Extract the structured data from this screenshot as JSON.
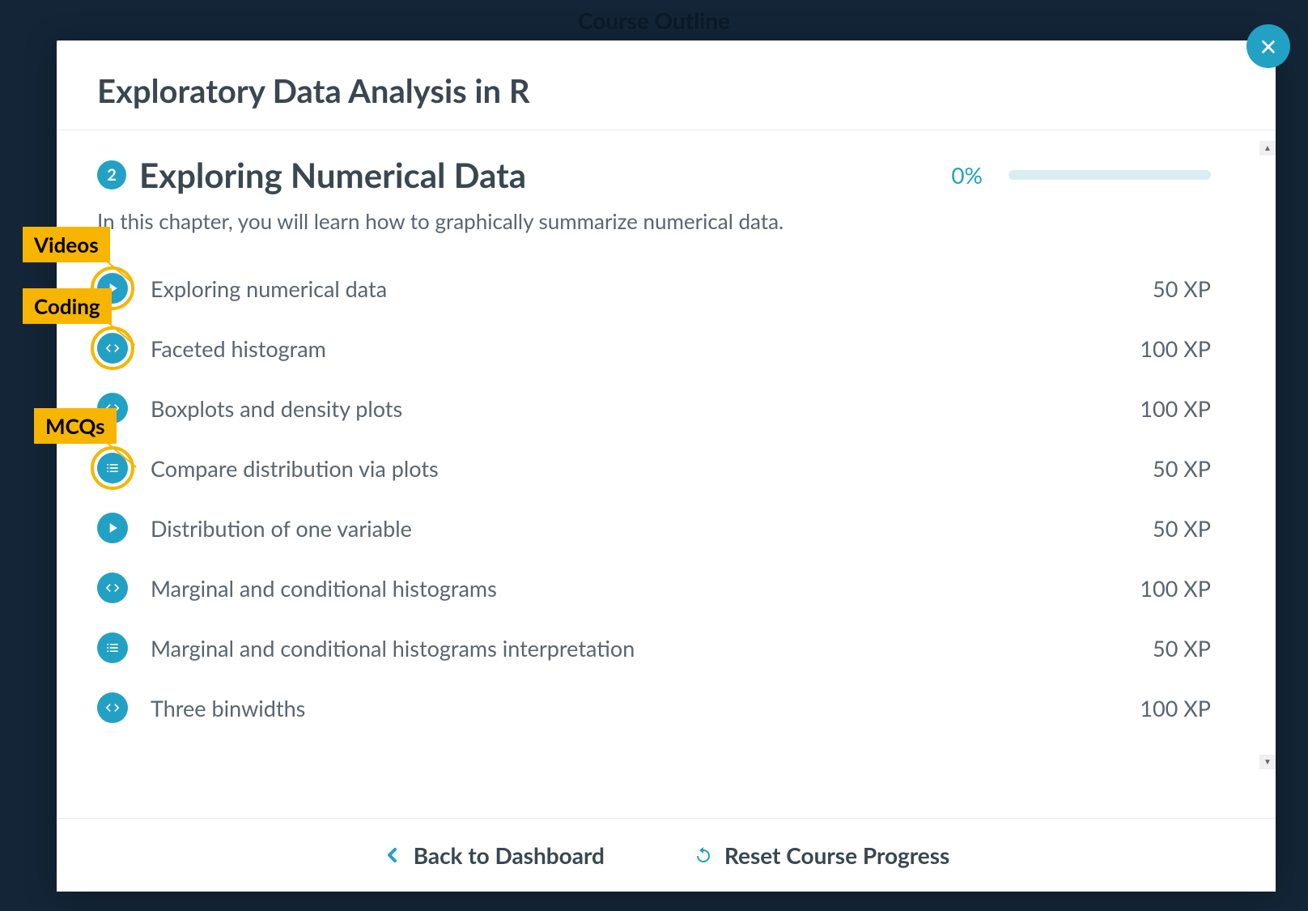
{
  "background_title": "Course Outline",
  "course_title": "Exploratory Data Analysis in R",
  "close_text": "✕",
  "chapter": {
    "number": "2",
    "title": "Exploring Numerical Data",
    "percent": "0%",
    "description": "In this chapter, you will learn how to graphically summarize numerical data."
  },
  "exercises": [
    {
      "icon": "play",
      "ringed": true,
      "title": "Exploring numerical data",
      "xp": "50 XP"
    },
    {
      "icon": "code",
      "ringed": true,
      "title": "Faceted histogram",
      "xp": "100 XP"
    },
    {
      "icon": "code",
      "ringed": false,
      "title": "Boxplots and density plots",
      "xp": "100 XP"
    },
    {
      "icon": "list",
      "ringed": true,
      "title": "Compare distribution via plots",
      "xp": "50 XP"
    },
    {
      "icon": "play",
      "ringed": false,
      "title": "Distribution of one variable",
      "xp": "50 XP"
    },
    {
      "icon": "code",
      "ringed": false,
      "title": "Marginal and conditional histograms",
      "xp": "100 XP"
    },
    {
      "icon": "list",
      "ringed": false,
      "title": "Marginal and conditional histograms interpretation",
      "xp": "50 XP"
    },
    {
      "icon": "code",
      "ringed": false,
      "title": "Three binwidths",
      "xp": "100 XP"
    }
  ],
  "footer": {
    "back": "Back to Dashboard",
    "reset": "Reset Course Progress"
  },
  "annotations": {
    "videos": "Videos",
    "coding": "Coding",
    "mcqs": "MCQs"
  }
}
